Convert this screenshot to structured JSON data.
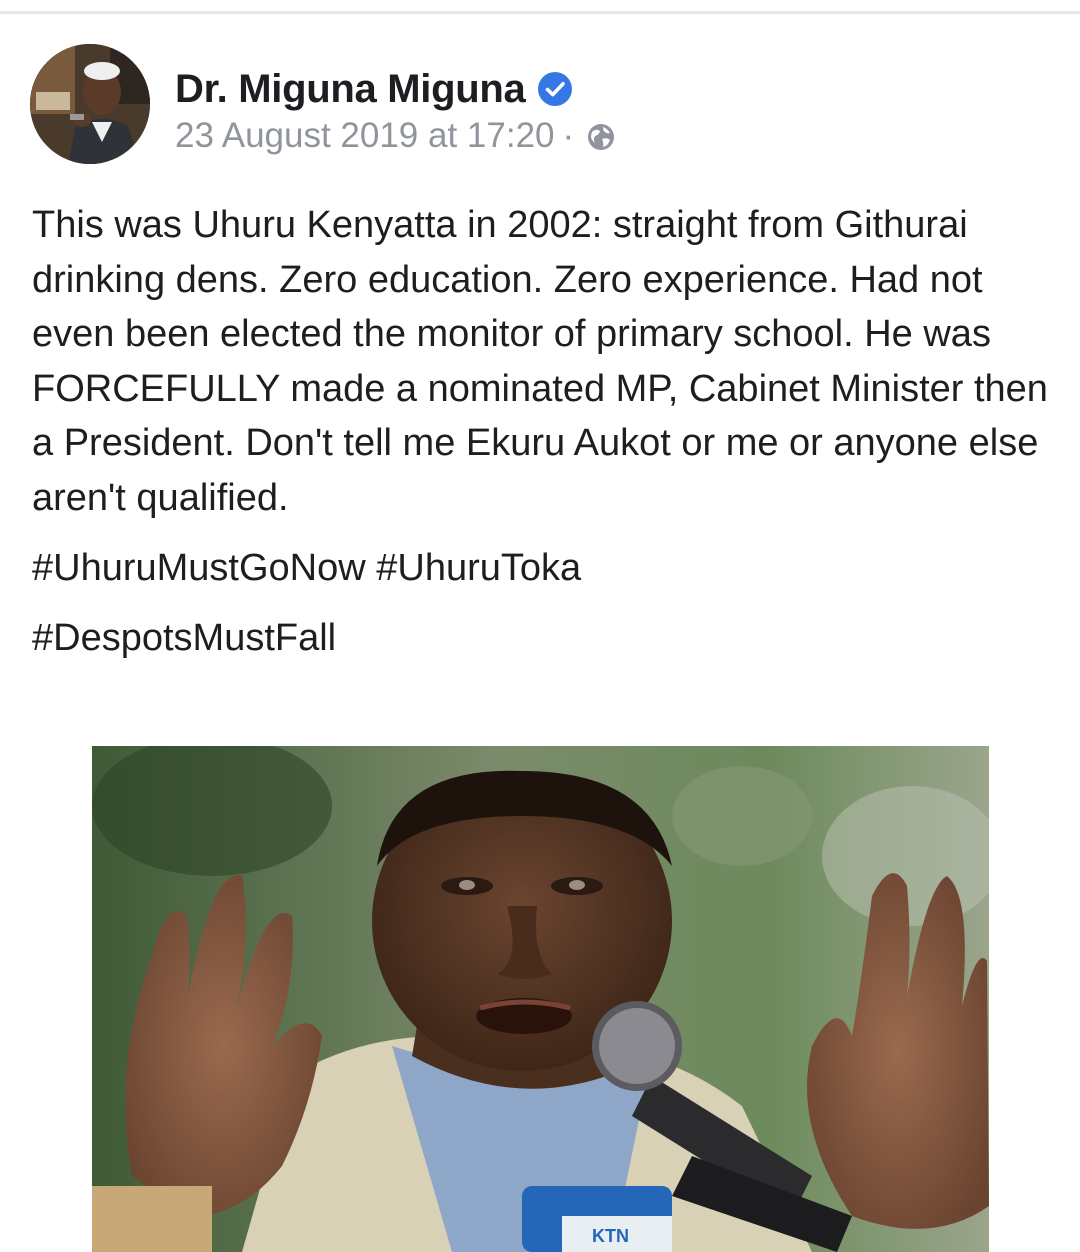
{
  "post": {
    "author": {
      "name": "Dr. Miguna Miguna",
      "verified": true,
      "avatar_icon": "profile-photo"
    },
    "timestamp": "23 August 2019 at 17:20",
    "separator": "·",
    "privacy_icon": "globe-icon",
    "text": "This was Uhuru Kenyatta in 2002: straight from Githurai drinking dens. Zero education. Zero experience. Had not even been elected the monitor of primary school. He was FORCEFULLY made a nominated MP, Cabinet Minister then a President. Don't tell me Ekuru Aukot or me or anyone else aren't qualified.",
    "hashtags_line1": [
      "#UhuruMustGoNow",
      "#UhuruToka"
    ],
    "hashtags_line2": [
      "#DespotsMustFall"
    ],
    "photo": {
      "microphone_label": "KTN"
    }
  },
  "colors": {
    "verified_badge": "#3578e5",
    "meta_text": "#90949c",
    "body_text": "#1c1e21"
  }
}
